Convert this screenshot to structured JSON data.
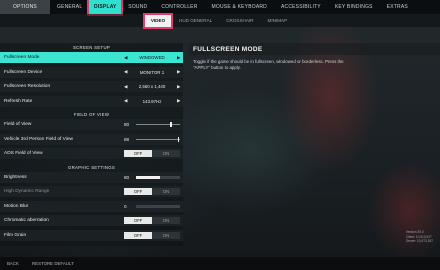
{
  "top_tabs": [
    "OPTIONS",
    "GENERAL",
    "DISPLAY",
    "SOUND",
    "CONTROLLER",
    "MOUSE & KEYBOARD",
    "ACCESSIBILITY",
    "KEY BINDINGS",
    "EXTRAS"
  ],
  "sub_tabs": [
    "VIDEO",
    "HUD GENERAL",
    "CROSSHAIR",
    "MINIMAP"
  ],
  "sections": {
    "screen_setup": "SCREEN SETUP",
    "field_of_view": "FIELD OF VIEW",
    "graphic_settings": "GRAPHIC SETTINGS"
  },
  "screen_setup": [
    {
      "label": "Fullscreen Mode",
      "value": "WINDOWED"
    },
    {
      "label": "Fullscreen Device",
      "value": "MONITOR 1"
    },
    {
      "label": "Fullscreen Resolution",
      "value": "2,560 x 1,440"
    },
    {
      "label": "Refresh Rate",
      "value": "143.97Hz"
    }
  ],
  "fov": {
    "fov_label": "Field of View",
    "fov_value": "80",
    "fov_level": 0.78,
    "vehicle_label": "Vehicle 3rd Person Field of View",
    "vehicle_value": "88",
    "vehicle_level": 0.95,
    "ads_label": "ADS Field of View",
    "ads_off": "OFF",
    "ads_on": "ON"
  },
  "graphics": {
    "brightness_label": "Brightness",
    "brightness_value": "80",
    "brightness_level": 0.55,
    "hdr_label": "High Dynamic Range",
    "hdr_off": "OFF",
    "hdr_on": "ON",
    "motion_label": "Motion Blur",
    "motion_value": "0",
    "motion_level": 0.0,
    "chromatic_label": "Chromatic aberration",
    "chromatic_off": "OFF",
    "chromatic_on": "ON",
    "grain_label": "Film Grain",
    "grain_off": "OFF",
    "grain_on": "ON"
  },
  "info": {
    "title": "FULLSCREEN MODE",
    "description": "Toggle if the game should be in fullscreen, windowed or borderless. Press the \"APPLY\" button to apply."
  },
  "version": [
    "Version 25.0",
    "Client: 10,913,927",
    "Server: 10,973,357"
  ],
  "bottom": {
    "back": "BACK",
    "restore": "RESTORE DEFAULT"
  },
  "colors": {
    "accent": "#3ce4d2",
    "highlight_outline": "#e23a6a"
  }
}
